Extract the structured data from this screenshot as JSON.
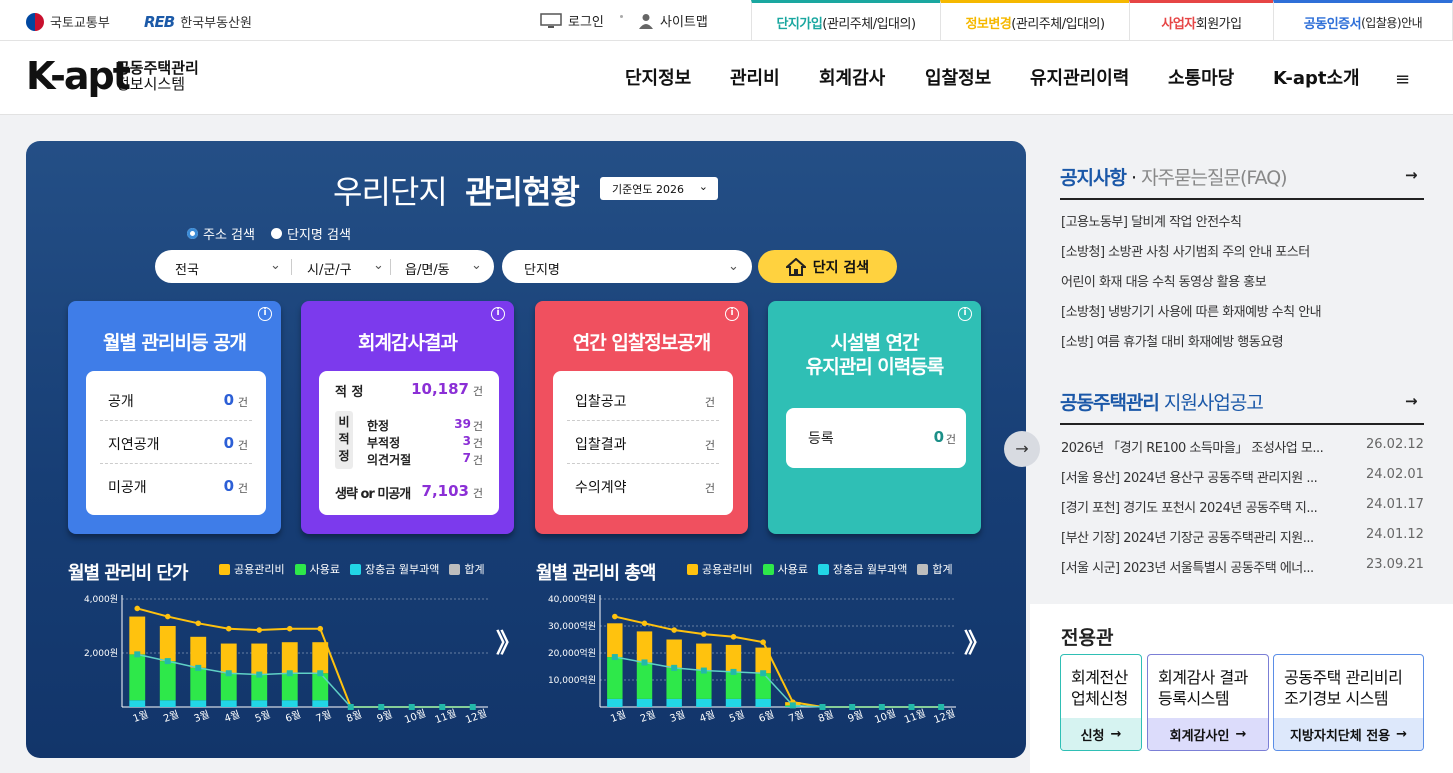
{
  "topbar": {
    "orgs": [
      "국토교통부",
      "한국부동산원"
    ],
    "reb_mark": "REB",
    "login": "로그인",
    "sitemap": "사이트맵",
    "tabs": [
      {
        "strong": "단지가입",
        "rest": "(관리주체/입대의)",
        "color": "#1aa7a0"
      },
      {
        "strong": "정보변경",
        "rest": "(관리주체/입대의)",
        "color": "#f5b800"
      },
      {
        "strong": "사업자",
        "rest": " 회원가입",
        "color": "#e64545"
      },
      {
        "strong": "공동인증서",
        "rest": " (입찰용)안내",
        "color": "#2e6fd8"
      }
    ]
  },
  "header": {
    "brand": "K-apt",
    "brand_sub1": "공동주택관리",
    "brand_sub2": "정보시스템",
    "nav": [
      "단지정보",
      "관리비",
      "회계감사",
      "입찰정보",
      "유지관리이력",
      "소통마당",
      "K-apt소개"
    ],
    "menu_icon": "≡"
  },
  "panel": {
    "title_light": "우리단지",
    "title_bold": "관리현황",
    "year_label": "기준연도 2026",
    "radio": [
      "주소 검색",
      "단지명 검색"
    ],
    "selects": [
      "전국",
      "시/군/구",
      "읍/면/동"
    ],
    "name_select": "단지명",
    "search_btn": "단지 검색"
  },
  "cards": {
    "c1": {
      "title": "월별 관리비등 공개",
      "rows": [
        [
          "공개",
          "0",
          "건"
        ],
        [
          "지연공개",
          "0",
          "건"
        ],
        [
          "미공개",
          "0",
          "건"
        ]
      ],
      "color": "#3f7de8"
    },
    "c2": {
      "title": "회계감사결과",
      "appropriate": "적 정",
      "appropriate_n": "10,187",
      "unit": "건",
      "non_label": "비적정",
      "non": [
        [
          "한정",
          "39"
        ],
        [
          "부적정",
          "3"
        ],
        [
          "의견거절",
          "7"
        ]
      ],
      "omit": "생략 or 미공개",
      "omit_n": "7,103",
      "color": "#7c3aed"
    },
    "c3": {
      "title": "연간 입찰정보공개",
      "rows": [
        [
          "입찰공고",
          "",
          "건"
        ],
        [
          "입찰결과",
          "",
          "건"
        ],
        [
          "수의계약",
          "",
          "건"
        ]
      ],
      "color": "#f0505f"
    },
    "c4": {
      "title1": "시설별 연간",
      "title2": "유지관리 이력등록",
      "row": [
        "등록",
        "0",
        "건"
      ],
      "color": "#2fbfb5"
    }
  },
  "charts_text": {
    "c1_title": "월별 관리비 단가",
    "c2_title": "월별 관리비 총액",
    "legend": [
      "공용관리비",
      "사용료",
      "장충금 월부과액",
      "합계"
    ],
    "legend_colors": [
      "#ffc20e",
      "#2ee84a",
      "#22d6e6",
      "#bdbdbd"
    ],
    "next_mark": "》"
  },
  "chart_data": [
    {
      "type": "bar",
      "title": "월별 관리비 단가",
      "categories": [
        "1월",
        "2월",
        "3월",
        "4월",
        "5월",
        "6월",
        "7월",
        "8월",
        "9월",
        "10월",
        "11월",
        "12월"
      ],
      "y_ticks": [
        "4,000원",
        "2,000원"
      ],
      "ylim": [
        0,
        4000
      ],
      "series": [
        {
          "name": "공용관리비",
          "values": [
            1400,
            1300,
            1150,
            1100,
            1150,
            1150,
            1150,
            0,
            0,
            0,
            0,
            0
          ]
        },
        {
          "name": "사용료",
          "values": [
            1700,
            1450,
            1200,
            1000,
            950,
            1000,
            1000,
            0,
            0,
            0,
            0,
            0
          ]
        },
        {
          "name": "장충금 월부과액",
          "values": [
            250,
            250,
            250,
            250,
            250,
            250,
            250,
            0,
            0,
            0,
            0,
            0
          ]
        },
        {
          "name": "합계",
          "values": [
            3650,
            3350,
            3100,
            2900,
            2850,
            2900,
            2900,
            0,
            0,
            0,
            0,
            0
          ]
        }
      ]
    },
    {
      "type": "bar",
      "title": "월별 관리비 총액",
      "categories": [
        "1월",
        "2월",
        "3월",
        "4월",
        "5월",
        "6월",
        "7월",
        "8월",
        "9월",
        "10월",
        "11월",
        "12월"
      ],
      "y_ticks": [
        "40,000억원",
        "30,000억원",
        "20,000억원",
        "10,000억원"
      ],
      "ylim": [
        0,
        40000
      ],
      "series": [
        {
          "name": "공용관리비",
          "values": [
            12500,
            11500,
            10500,
            10000,
            10000,
            9500,
            1200,
            0,
            0,
            0,
            0,
            0
          ]
        },
        {
          "name": "사용료",
          "values": [
            15500,
            13500,
            11500,
            10500,
            10000,
            9500,
            400,
            0,
            0,
            0,
            0,
            0
          ]
        },
        {
          "name": "장충금 월부과액",
          "values": [
            3000,
            3000,
            3000,
            3000,
            3000,
            3000,
            200,
            0,
            0,
            0,
            0,
            0
          ]
        },
        {
          "name": "합계",
          "values": [
            33500,
            31000,
            28500,
            27000,
            26000,
            24000,
            1800,
            0,
            0,
            0,
            0,
            0
          ]
        }
      ]
    }
  ],
  "side": {
    "notice_head": "공지사항",
    "faq_head": "자주묻는질문(FAQ)",
    "dot": "·",
    "go": "→",
    "notices": [
      "[고용노동부] 달비계 작업 안전수칙",
      "[소방청] 소방관 사칭 사기범죄 주의 안내 포스터",
      "어린이 화재 대응 수칙 동영상 활용 홍보",
      "[소방청] 냉방기기 사용에 따른 화재예방 수칙 안내",
      "[소방] 여름 휴가철 대비 화재예방 행동요령"
    ],
    "support_head_bold": "공동주택관리",
    "support_head_rest": " 지원사업공고",
    "support": [
      {
        "title": "2026년 「경기 RE100 소득마을」 조성사업 모...",
        "date": "26.02.12"
      },
      {
        "title": "[서울 용산] 2024년 용산구 공동주택 관리지원 ...",
        "date": "24.02.01"
      },
      {
        "title": "[경기 포천] 경기도 포천시 2024년 공동주택 지...",
        "date": "24.01.17"
      },
      {
        "title": "[부산 기장] 2024년 기장군 공동주택관리 지원...",
        "date": "24.01.12"
      },
      {
        "title": "[서울 시군] 2023년 서울특별시 공동주택 에너...",
        "date": "23.09.21"
      }
    ],
    "dedicated_head": "전용관",
    "dedicated": [
      {
        "t1": "회계전산",
        "t2": "업체신청",
        "btn": "신청",
        "color": "#2fbfb5",
        "bg": "#d6f3f1"
      },
      {
        "t1": "회계감사 결과",
        "t2": "등록시스템",
        "btn": "회계감사인",
        "color": "#7b7fd6",
        "bg": "#dcdcfb"
      },
      {
        "t1": "공동주택 관리비리",
        "t2": "조기경보 시스템",
        "btn": "지방자치단체 전용",
        "color": "#5b8ee6",
        "bg": "#dde8fb"
      }
    ]
  }
}
